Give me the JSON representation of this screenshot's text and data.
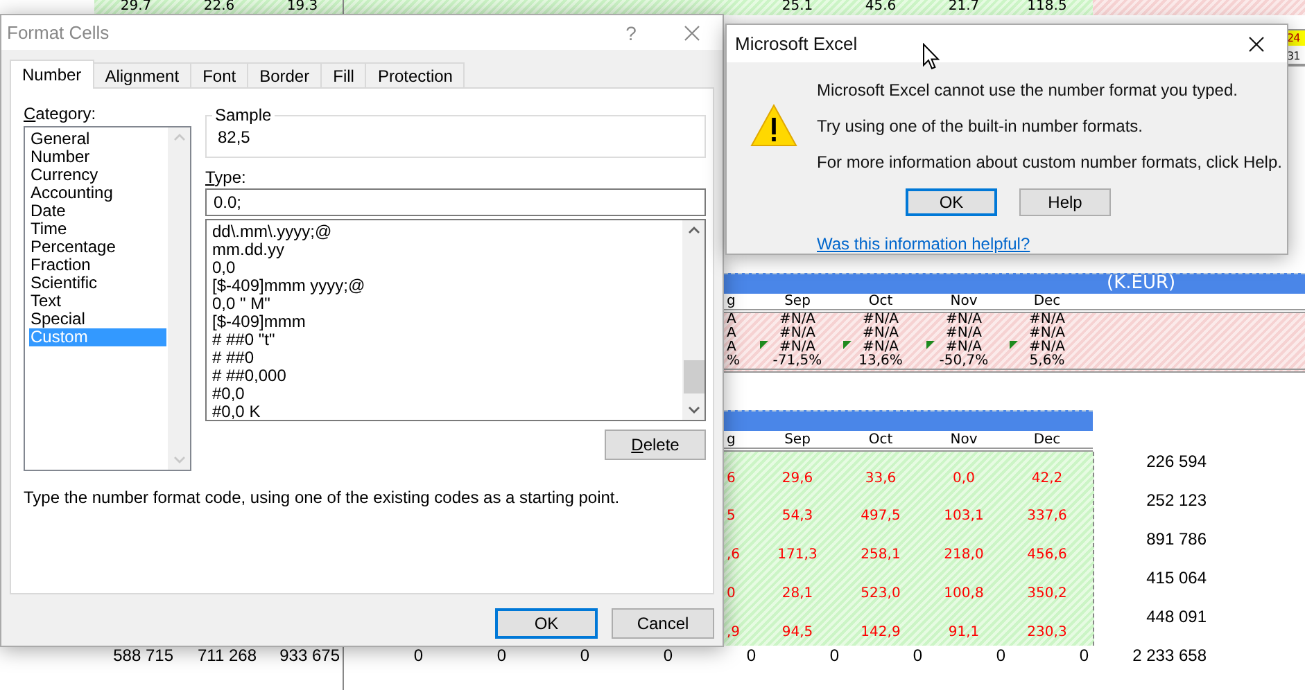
{
  "spreadsheet": {
    "top_row": {
      "left_values": [
        "29.7",
        "22.6",
        "19.3"
      ],
      "right_values": [
        "25.1",
        "45.6",
        "21.7",
        "118.5"
      ]
    },
    "edge_cells": [
      {
        "value": "24",
        "highlighted": true
      },
      {
        "value": "31",
        "highlighted": false
      }
    ],
    "variance_table": {
      "title": "(K.EUR)",
      "columns": [
        "g",
        "Sep",
        "Oct",
        "Nov",
        "Dec"
      ],
      "rows": [
        {
          "cells": [
            "A",
            "#N/A",
            "#N/A",
            "#N/A",
            "#N/A"
          ],
          "error_marks": false
        },
        {
          "cells": [
            "A",
            "#N/A",
            "#N/A",
            "#N/A",
            "#N/A"
          ],
          "error_marks": false
        },
        {
          "cells": [
            "A",
            "#N/A",
            "#N/A",
            "#N/A",
            "#N/A"
          ],
          "error_marks": true
        },
        {
          "cells": [
            "%",
            "-71,5%",
            "13,6%",
            "-50,7%",
            "5,6%"
          ],
          "error_marks": false
        }
      ]
    },
    "amounts_table": {
      "columns": [
        "g",
        "Sep",
        "Oct",
        "Nov",
        "Dec"
      ],
      "rows": [
        [
          "6",
          "29,6",
          "33,6",
          "0,0",
          "42,2"
        ],
        [
          "5",
          "54,3",
          "497,5",
          "103,1",
          "337,6"
        ],
        [
          ",6",
          "171,3",
          "258,1",
          "218,0",
          "456,6"
        ],
        [
          "0",
          "28,1",
          "523,0",
          "100,8",
          "350,2"
        ],
        [
          ",9",
          "94,5",
          "142,9",
          "91,1",
          "230,3"
        ]
      ],
      "row_totals": [
        "226 594",
        "252 123",
        "891 786",
        "415 064",
        "448 091"
      ]
    },
    "footer": {
      "values": [
        "588 715",
        "711 268",
        "933 675",
        "0",
        "0",
        "0",
        "0",
        "0",
        "0",
        "0",
        "0",
        "0"
      ],
      "grand_total": "2 233 658"
    }
  },
  "format_cells": {
    "title": "Format Cells",
    "help_glyph": "?",
    "tabs": [
      {
        "label": "Number",
        "selected": true
      },
      {
        "label": "Alignment",
        "selected": false
      },
      {
        "label": "Font",
        "selected": false
      },
      {
        "label": "Border",
        "selected": false
      },
      {
        "label": "Fill",
        "selected": false
      },
      {
        "label": "Protection",
        "selected": false
      }
    ],
    "category_label": "Category:",
    "categories": [
      {
        "label": "General",
        "selected": false
      },
      {
        "label": "Number",
        "selected": false
      },
      {
        "label": "Currency",
        "selected": false
      },
      {
        "label": "Accounting",
        "selected": false
      },
      {
        "label": "Date",
        "selected": false
      },
      {
        "label": "Time",
        "selected": false
      },
      {
        "label": "Percentage",
        "selected": false
      },
      {
        "label": "Fraction",
        "selected": false
      },
      {
        "label": "Scientific",
        "selected": false
      },
      {
        "label": "Text",
        "selected": false
      },
      {
        "label": "Special",
        "selected": false
      },
      {
        "label": "Custom",
        "selected": true
      }
    ],
    "sample": {
      "label": "Sample",
      "value": "82,5"
    },
    "type_label": "Type:",
    "type_value": "0.0;",
    "formats": [
      "dd\\.mm\\.yyyy;@",
      "mm.dd.yy",
      "0,0",
      "[$-409]mmm yyyy;@",
      "0,0  \" M\"",
      "[$-409]mmm",
      "# ##0 \"t\"",
      "# ##0",
      "# ##0,000",
      "#0,0",
      "#0,0 K"
    ],
    "delete_button": "Delete",
    "description": "Type the number format code, using one of the existing codes as a starting point.",
    "buttons": [
      {
        "label": "OK",
        "default": true
      },
      {
        "label": "Cancel",
        "default": false
      }
    ]
  },
  "alert": {
    "title": "Microsoft Excel",
    "messages": [
      "Microsoft Excel cannot use the number format you typed.",
      "Try using one of the built-in number formats.",
      "For more information about custom number formats, click Help."
    ],
    "buttons": [
      {
        "label": "OK",
        "default": true
      },
      {
        "label": "Help",
        "default": false
      }
    ],
    "link": "Was this information helpful?"
  }
}
